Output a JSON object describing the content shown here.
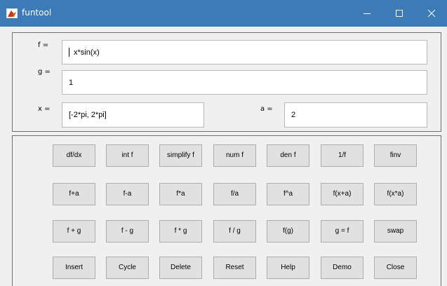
{
  "window": {
    "title": "funtool",
    "icon": "matlab-icon",
    "controls": [
      "minimize-icon",
      "maximize-icon",
      "close-icon"
    ]
  },
  "fields": {
    "f": {
      "label": "f =",
      "value": "x*sin(x)"
    },
    "g": {
      "label": "g =",
      "value": "1"
    },
    "x": {
      "label": "x =",
      "value": "[-2*pi, 2*pi]"
    },
    "a": {
      "label": "a =",
      "value": "2"
    }
  },
  "buttons": {
    "row1": [
      "df/dx",
      "int f",
      "simplify f",
      "num f",
      "den f",
      "1/f",
      "finv"
    ],
    "row2": [
      "f+a",
      "f-a",
      "f*a",
      "f/a",
      "f^a",
      "f(x+a)",
      "f(x*a)"
    ],
    "row3": [
      "f + g",
      "f - g",
      "f * g",
      "f / g",
      "f(g)",
      "g = f",
      "swap"
    ],
    "row4": [
      "Insert",
      "Cycle",
      "Delete",
      "Reset",
      "Help",
      "Demo",
      "Close"
    ]
  }
}
